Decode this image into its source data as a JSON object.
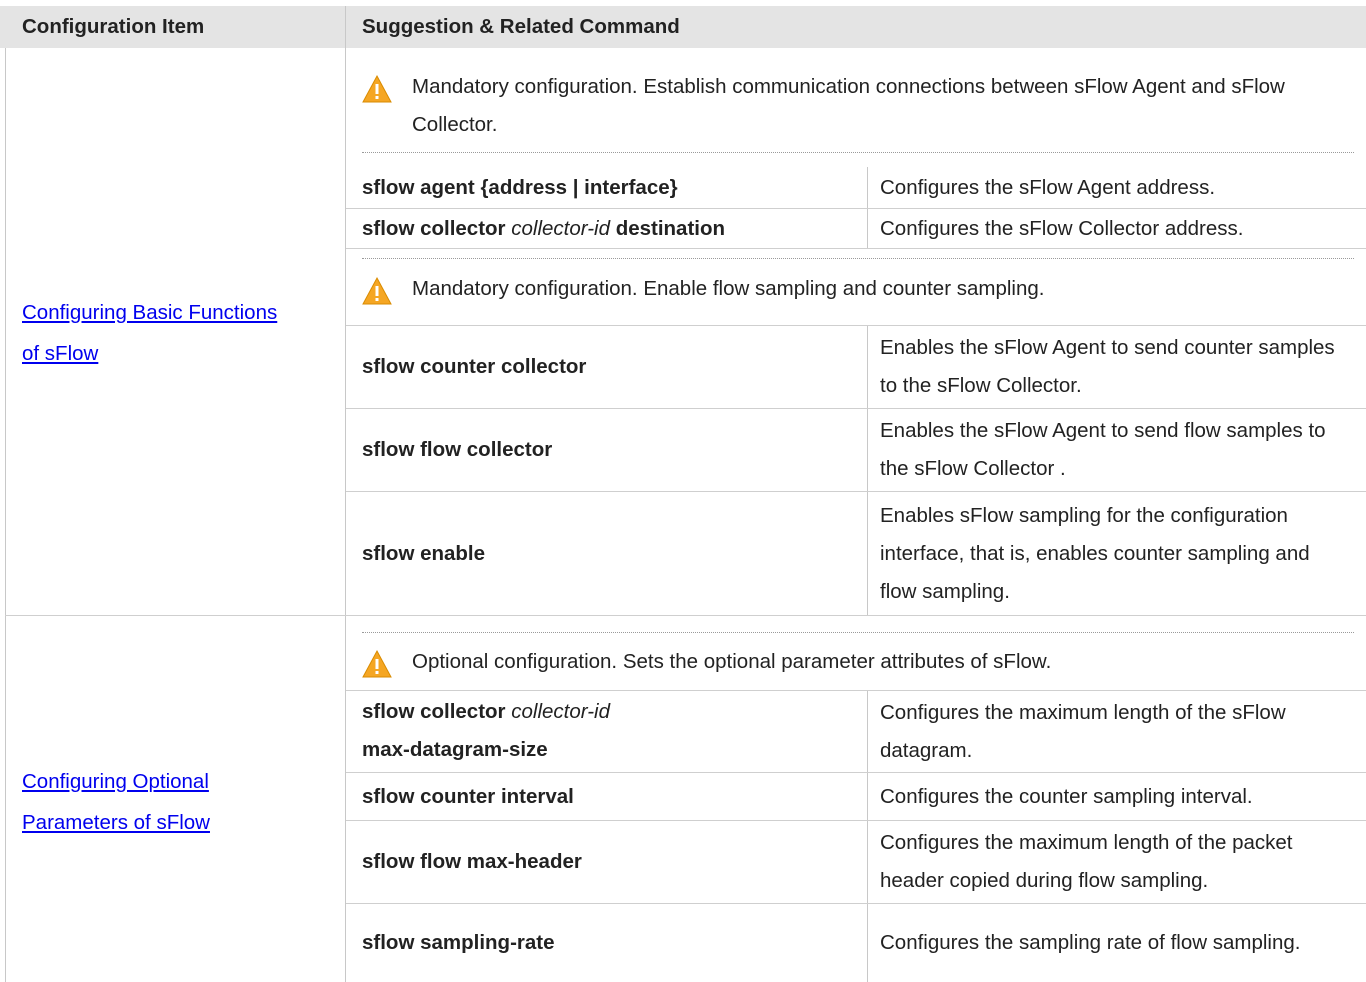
{
  "header": {
    "col1": "Configuration Item",
    "col2": "Suggestion & Related Command"
  },
  "section1": {
    "link_line1": "Configuring Basic Functions",
    "link_line2": "of sFlow",
    "note1": "Mandatory configuration. Establish communication connections between sFlow Agent and sFlow Collector.",
    "rows1": [
      {
        "cmd_bold": "sflow agent {address | interface}",
        "desc": "Configures the sFlow Agent address."
      },
      {
        "cmd_bold": "sflow collector",
        "cmd_italic": "collector-id",
        "cmd_bold2": "destination",
        "desc": "Configures the sFlow Collector address."
      }
    ],
    "note2": "Mandatory configuration. Enable flow sampling and counter sampling.",
    "rows2": [
      {
        "cmd": "sflow counter collector",
        "desc": "Enables the sFlow Agent to send counter samples to the sFlow Collector."
      },
      {
        "cmd": "sflow flow collector",
        "desc": "Enables the sFlow Agent to send flow samples to the sFlow Collector ."
      },
      {
        "cmd": "sflow enable",
        "desc": "Enables sFlow sampling for the configuration interface, that is, enables counter sampling and flow sampling."
      }
    ]
  },
  "section2": {
    "link_line1": "Configuring Optional",
    "link_line2": "Parameters of sFlow",
    "note": "Optional configuration. Sets the optional parameter attributes of sFlow.",
    "rows": [
      {
        "cmd_bold": "sflow collector",
        "cmd_italic": "collector-id",
        "cmd_line2": "max-datagram-size",
        "desc": "Configures the maximum length of the sFlow datagram."
      },
      {
        "cmd": "sflow counter interval",
        "desc": "Configures the counter sampling interval."
      },
      {
        "cmd": "sflow flow max-header",
        "desc": "Configures the maximum length of the packet header copied during flow sampling."
      },
      {
        "cmd": "sflow sampling-rate",
        "desc": "Configures the sampling rate of flow sampling."
      }
    ]
  },
  "icons": {
    "warning": "warning-triangle-icon",
    "warning_color": "#f5a623"
  }
}
